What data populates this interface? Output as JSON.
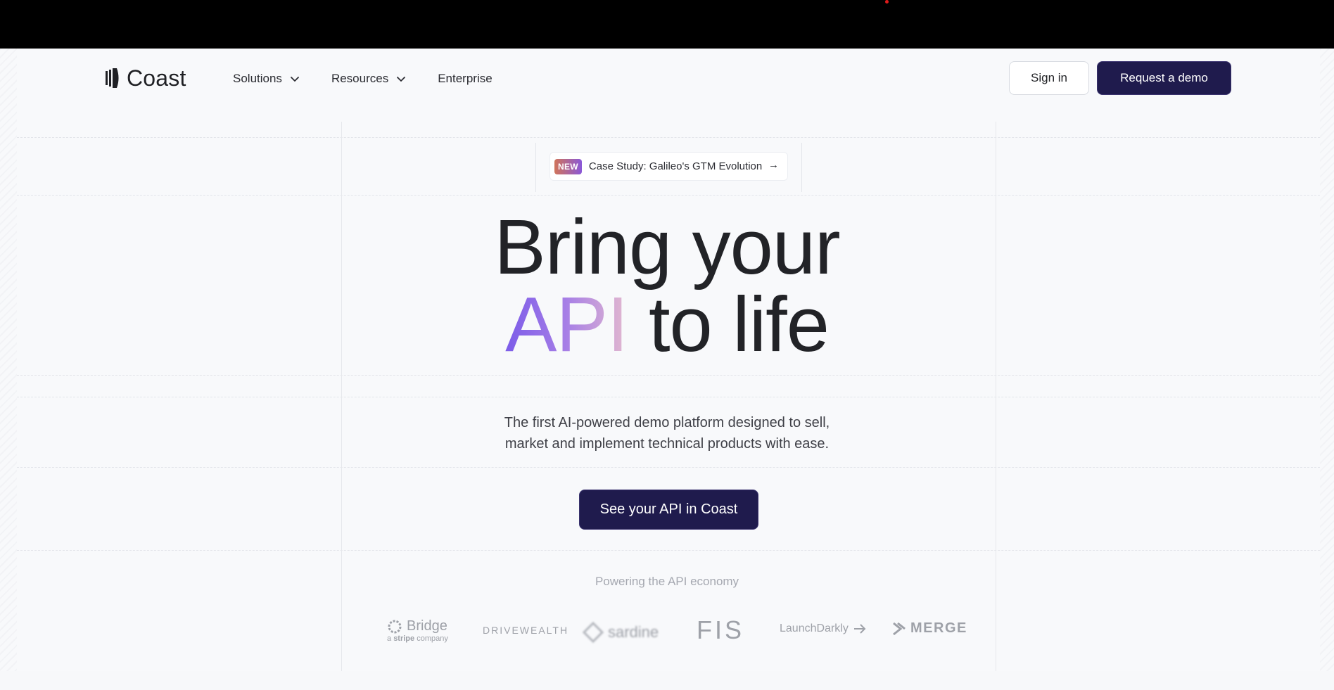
{
  "nav": {
    "logo_text": "Coast",
    "items": [
      {
        "label": "Solutions",
        "has_dropdown": true
      },
      {
        "label": "Resources",
        "has_dropdown": true
      },
      {
        "label": "Enterprise",
        "has_dropdown": false
      }
    ],
    "signin_label": "Sign in",
    "demo_label": "Request a demo"
  },
  "badge": {
    "tag": "NEW",
    "text": "Case Study: Galileo's GTM Evolution",
    "arrow": "→"
  },
  "hero": {
    "line1": "Bring your",
    "line2_highlight": "API",
    "line2_rest": " to life",
    "subtitle_line1": "The first AI-powered demo platform designed to sell,",
    "subtitle_line2": "market and implement technical products with ease.",
    "cta_label": "See your API in Coast"
  },
  "logos": {
    "heading": "Powering the API economy",
    "bridge": "Bridge",
    "bridge_sub_prefix": "a ",
    "bridge_sub_brand": "stripe",
    "bridge_sub_suffix": " company",
    "drivewealth": "DRIVEWEALTH",
    "sardine": "sardine",
    "fis": "FIS",
    "launchdarkly": "LaunchDarkly",
    "merge": "MERGE"
  },
  "colors": {
    "primary": "#1f1b4d",
    "background": "#f8f9fb",
    "api_gradient": [
      "#7c5ce9",
      "#e3b9cf"
    ]
  }
}
